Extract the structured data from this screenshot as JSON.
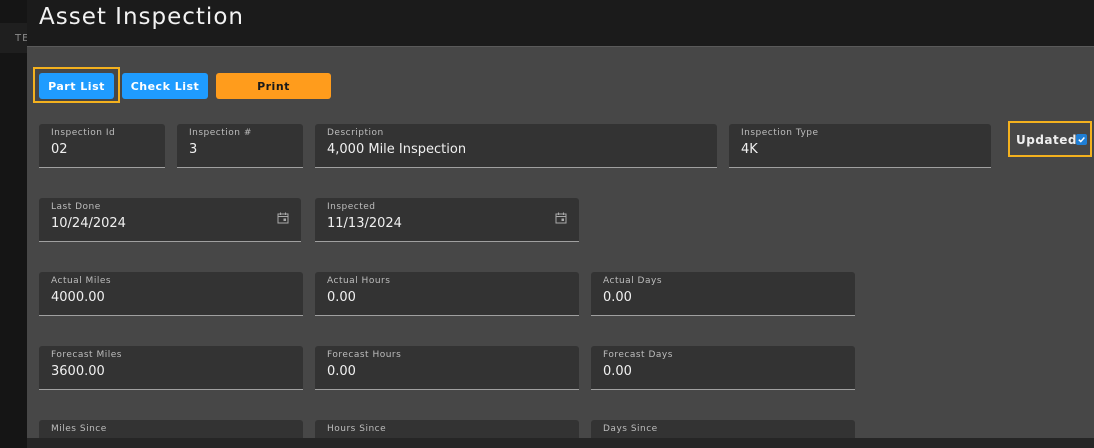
{
  "app": {
    "title": "Asset Inspection",
    "background_tab": "TE"
  },
  "toolbar": {
    "part_list": "Part List",
    "check_list": "Check List",
    "print": "Print"
  },
  "fields": {
    "inspection_id": {
      "label": "Inspection Id",
      "value": "02"
    },
    "inspection_no": {
      "label": "Inspection #",
      "value": "3"
    },
    "description": {
      "label": "Description",
      "value": "4,000 Mile Inspection"
    },
    "inspection_type": {
      "label": "Inspection Type",
      "value": "4K"
    },
    "last_done": {
      "label": "Last Done",
      "value": "10/24/2024"
    },
    "inspected": {
      "label": "Inspected",
      "value": "11/13/2024"
    },
    "actual_miles": {
      "label": "Actual Miles",
      "value": "4000.00"
    },
    "actual_hours": {
      "label": "Actual Hours",
      "value": "0.00"
    },
    "actual_days": {
      "label": "Actual Days",
      "value": "0.00"
    },
    "forecast_miles": {
      "label": "Forecast Miles",
      "value": "3600.00"
    },
    "forecast_hours": {
      "label": "Forecast Hours",
      "value": "0.00"
    },
    "forecast_days": {
      "label": "Forecast Days",
      "value": "0.00"
    },
    "miles_since": {
      "label": "Miles Since",
      "value": ""
    },
    "hours_since": {
      "label": "Hours Since",
      "value": ""
    },
    "days_since": {
      "label": "Days Since",
      "value": ""
    }
  },
  "updated": {
    "label": "Updated",
    "checked": true
  },
  "colors": {
    "accent_blue": "#1f9cff",
    "accent_orange": "#ff9c1c",
    "highlight": "#f4b11e"
  }
}
